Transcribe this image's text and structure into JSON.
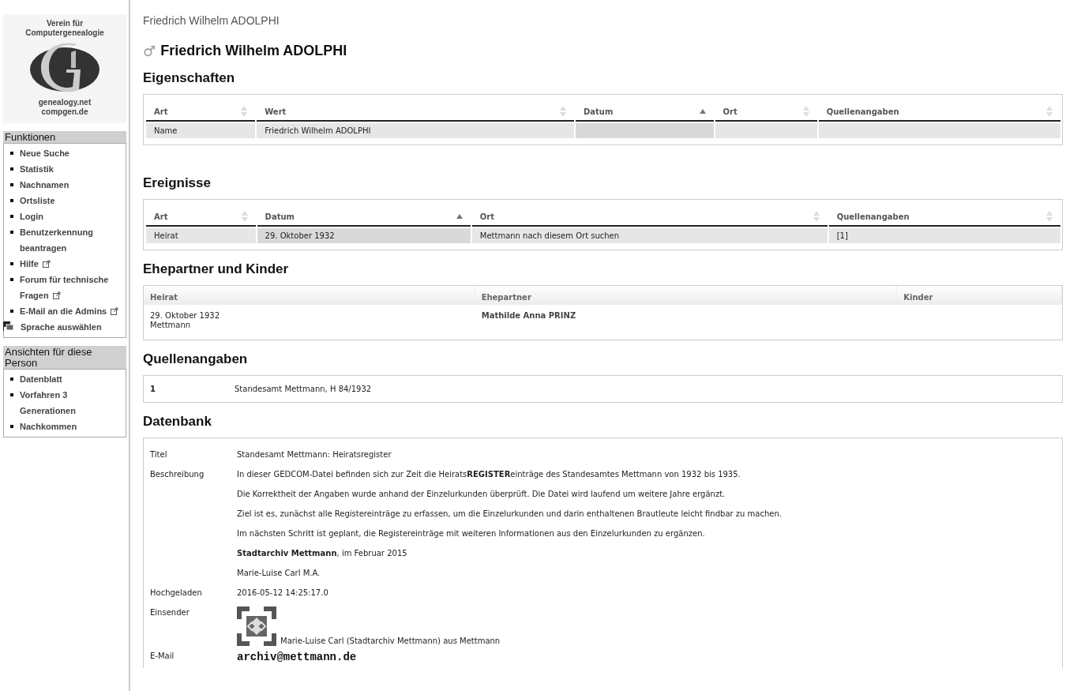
{
  "logo": {
    "top": "Verein für Computergenealogie",
    "bottom_lines": [
      "genealogy.net",
      "compgen.de"
    ]
  },
  "sidebar": [
    {
      "title": "Funktionen",
      "items": [
        {
          "label": "Neue Suche",
          "kind": "link",
          "external": false
        },
        {
          "label": "Statistik",
          "kind": "link",
          "external": false
        },
        {
          "label": "Nachnamen",
          "kind": "link",
          "external": false
        },
        {
          "label": "Ortsliste",
          "kind": "link",
          "external": false
        },
        {
          "label": "Login",
          "kind": "link",
          "external": false
        },
        {
          "label": "Benutzerkennung beantragen",
          "kind": "link",
          "external": false
        },
        {
          "label": "Hilfe",
          "kind": "link",
          "external": true
        },
        {
          "label": "Forum für technische Fragen",
          "kind": "link",
          "external": true
        },
        {
          "label": "E-Mail an die Admins",
          "kind": "link",
          "external": true
        },
        {
          "label": "Sprache auswählen",
          "kind": "language",
          "external": false
        }
      ]
    },
    {
      "title": "Ansichten für diese Person",
      "items": [
        {
          "label": "Datenblatt",
          "kind": "link",
          "external": false
        },
        {
          "label": "Vorfahren 3 Generationen",
          "kind": "link",
          "external": false
        },
        {
          "label": "Nachkommen",
          "kind": "link",
          "external": false
        }
      ]
    }
  ],
  "breadcrumb": "Friedrich Wilhelm ADOLPHI",
  "person": {
    "name": "Friedrich Wilhelm ADOLPHI",
    "sex_symbol": "♂"
  },
  "properties": {
    "heading": "Eigenschaften",
    "columns": [
      {
        "label": "Art",
        "sorted": false
      },
      {
        "label": "Wert",
        "sorted": false
      },
      {
        "label": "Datum",
        "sorted": true
      },
      {
        "label": "Ort",
        "sorted": false
      },
      {
        "label": "Quellenangaben",
        "sorted": false
      }
    ],
    "rows": [
      [
        "Name",
        "Friedrich Wilhelm ADOLPHI",
        "",
        "",
        ""
      ]
    ]
  },
  "events": {
    "heading": "Ereignisse",
    "columns": [
      {
        "label": "Art",
        "sorted": false
      },
      {
        "label": "Datum",
        "sorted": true
      },
      {
        "label": "Ort",
        "sorted": false
      },
      {
        "label": "Quellenangaben",
        "sorted": false
      }
    ],
    "rows": [
      [
        "Heirat",
        "29. Oktober 1932",
        "Mettmann nach diesem Ort suchen",
        "[1]"
      ]
    ]
  },
  "family": {
    "heading": "Ehepartner und Kinder",
    "columns": [
      "Heirat",
      "Ehepartner",
      "Kinder"
    ],
    "rows": [
      {
        "date": "29. Oktober 1932",
        "place": "Mettmann",
        "spouse": "Mathilde Anna PRINZ"
      }
    ]
  },
  "sources": {
    "heading": "Quellenangaben",
    "rows": [
      {
        "number": "1",
        "text": "Standesamt Mettmann, H 84/1932"
      }
    ]
  },
  "database": {
    "heading": "Datenbank",
    "rows": [
      {
        "label": "Titel",
        "kind": "text",
        "lines": [
          "Standesamt Mettmann: Heiratsregister"
        ]
      },
      {
        "label": "Beschreibung",
        "kind": "text",
        "lines": [
          "In dieser GEDCOM-Datei befinden sich zur Zeit die Heirats**REGISTER**einträge des Standesamtes Mettmann von 1932 bis 1935.",
          "Die Korrektheit der Angaben wurde anhand der Einzelurkunden überprüft. Die Datei wird laufend um weitere Jahre ergänzt.",
          "Ziel ist es, zunächst alle Registereinträge zu erfassen, um die Einzelurkunden und darin enthaltenen Brautleute leicht findbar zu machen.",
          "Im nächsten Schritt ist geplant, die Registereinträge mit weiteren Informationen aus den Einzelurkunden zu ergänzen.",
          "**Stadtarchiv Mettmann**, im Februar 2015",
          "Marie-Luise Carl M.A."
        ]
      },
      {
        "label": "Hochgeladen",
        "kind": "text",
        "lines": [
          "2016-05-12 14:25:17.0"
        ]
      },
      {
        "label": "Einsender",
        "kind": "submitter",
        "lines": [
          "Marie-Luise Carl (Stadtarchiv Mettmann) aus Mettmann"
        ]
      },
      {
        "label": "E-Mail",
        "kind": "email",
        "lines": [
          "archiv@mettmann.de"
        ]
      }
    ]
  }
}
